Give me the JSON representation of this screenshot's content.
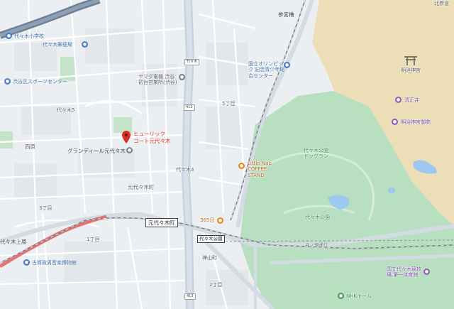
{
  "map": {
    "colors": {
      "land": "#eceff2",
      "block": "#e4e7eb",
      "park": "#b7dfc0",
      "shrine_area": "#ecdfb7",
      "water": "#9ec8ef",
      "road_major": "#c7d3de",
      "road_minor": "#ffffff",
      "rail": "#7a8087",
      "pin": "#d93025",
      "rail_highlight": "#e57373"
    },
    "selected_place": {
      "name_line1": "ヒューリック",
      "name_line2": "コート元代々木",
      "icon": "map-pin-icon"
    },
    "station_labels": [
      {
        "id": "motoyoyogicho",
        "text": "元代々木町"
      },
      {
        "id": "yoyogi-koen-station",
        "text": "代々木公園"
      },
      {
        "id": "yoyogi-uehara",
        "text": "代々木上原"
      }
    ],
    "area_labels": [
      {
        "id": "higashi",
        "text": "西原"
      },
      {
        "id": "motoyoyogi",
        "text": "元代々木町"
      },
      {
        "id": "yoyogi-5",
        "text": "代々木5"
      },
      {
        "id": "yoyogi-4",
        "text": "代々木4"
      },
      {
        "id": "tomigaya-1",
        "text": "1丁目"
      },
      {
        "id": "tomigaya-2",
        "text": "2丁目"
      },
      {
        "id": "chome-5",
        "text": "5丁目"
      },
      {
        "id": "chome-3",
        "text": "3丁目"
      },
      {
        "id": "kamiyama",
        "text": "神山町"
      },
      {
        "id": "yoyogi-koen",
        "text": "代々木公園"
      },
      {
        "id": "yoyogi-koen-dog",
        "text": "代々木公園 ドッグラン"
      },
      {
        "id": "meiji-jingu",
        "text": "明治神宮"
      },
      {
        "id": "iwaido",
        "text": "井ノ頭通り"
      }
    ],
    "pois": [
      {
        "id": "kousaku",
        "text": "代々木小学校",
        "icon": "school-icon",
        "kind": "blue"
      },
      {
        "id": "sports-center",
        "text": "渋谷区スポーツセンター",
        "icon": "sports-icon",
        "kind": "blue"
      },
      {
        "id": "yoyogi-post",
        "text": "代々木郵便局",
        "icon": "post-office-icon",
        "kind": "blue"
      },
      {
        "id": "yamada",
        "text": "ヤマダ電機 渋谷 初台営業所(渋谷)",
        "icon": "store-icon",
        "kind": "gray"
      },
      {
        "id": "grandheel",
        "text": "グランディール元代々木",
        "icon": "building-icon",
        "kind": "gray"
      },
      {
        "id": "olympic-center",
        "text": "国立オリンピック 記念青少年総合センター",
        "icon": "building-icon",
        "kind": "blue"
      },
      {
        "id": "meiji-shrine",
        "text": "明治神宮",
        "icon": "shrine-icon",
        "kind": "purple"
      },
      {
        "id": "kiyomasa",
        "text": "清正井",
        "icon": "well-icon",
        "kind": "purple"
      },
      {
        "id": "meiji-museum",
        "text": "明治神宮御苑",
        "icon": "museum-icon",
        "kind": "purple"
      },
      {
        "id": "little-nap",
        "text": "Little Nap COFFEE STAND",
        "icon": "cafe-icon",
        "kind": "orange"
      },
      {
        "id": "365",
        "text": "365日",
        "icon": "bakery-icon",
        "kind": "orange"
      },
      {
        "id": "nhk",
        "text": "NHKホール",
        "icon": "hall-icon",
        "kind": "green"
      },
      {
        "id": "gym",
        "text": "国立代々木競技場 第一体育館",
        "icon": "stadium-icon",
        "kind": "purple"
      },
      {
        "id": "koga",
        "text": "古賀政男音楽博物館",
        "icon": "museum-icon",
        "kind": "blue"
      },
      {
        "id": "sangubashi",
        "text": "参宮橋",
        "icon": "station-icon",
        "kind": "gray"
      },
      {
        "id": "meiji-fusai",
        "text": "北参道",
        "icon": "road-icon",
        "kind": "gray"
      }
    ],
    "road_shields": [
      {
        "id": "r1",
        "text": "413"
      },
      {
        "id": "r2",
        "text": "413"
      },
      {
        "id": "r3",
        "text": "代々木"
      }
    ]
  }
}
